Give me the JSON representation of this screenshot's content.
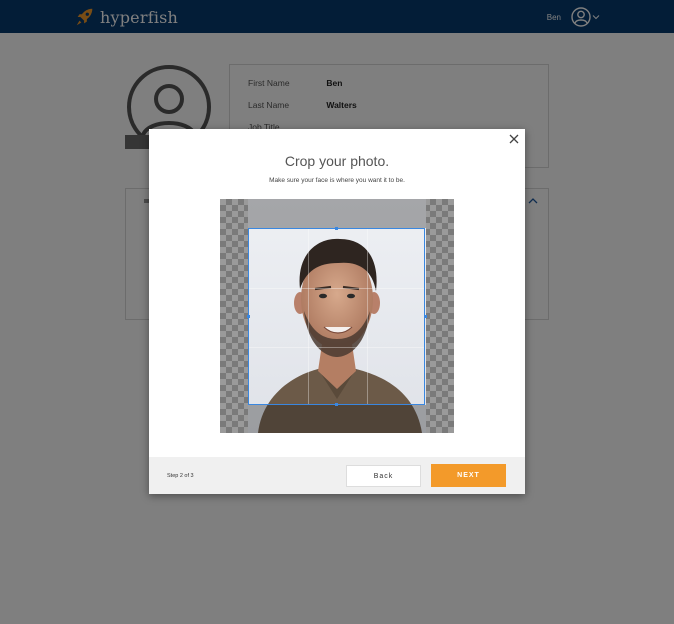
{
  "app": {
    "brand": "hyperfish",
    "user_name": "Ben"
  },
  "profile": {
    "fields": [
      {
        "label": "First Name",
        "value": "Ben"
      },
      {
        "label": "Last Name",
        "value": "Walters"
      },
      {
        "label": "Job Title",
        "value": ""
      }
    ]
  },
  "modal": {
    "title": "Crop your photo.",
    "subtitle": "Make sure your face is where you want it to be.",
    "step": "Step 2 of 3",
    "back_label": "Back",
    "next_label": "NEXT"
  },
  "colors": {
    "header_bg": "#073b6f",
    "accent_orange": "#f39a2a",
    "crop_border": "#3a87e0"
  },
  "icons": {
    "logo": "rocket-icon",
    "close": "close-icon",
    "user": "user-avatar-icon",
    "chevron": "chevron-down-icon"
  }
}
